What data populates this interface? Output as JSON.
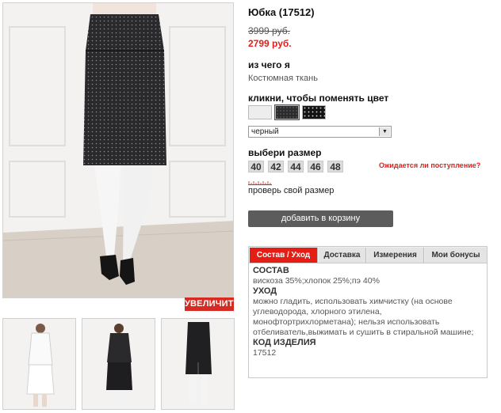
{
  "product": {
    "title": "Юбка (17512)",
    "old_price": "3999 руб.",
    "new_price": "2799 руб."
  },
  "material": {
    "heading": "из чего я",
    "value": "Костюмная ткань"
  },
  "color": {
    "heading": "кликни, чтобы поменять цвет",
    "selected": "черный",
    "swatches": [
      {
        "name": "white",
        "color": "#ededed"
      },
      {
        "name": "black-dotted",
        "color": "#2b2b2e"
      },
      {
        "name": "black-white-dotted",
        "color": "#141414"
      }
    ]
  },
  "size": {
    "heading": "выбери размер",
    "options": [
      "40",
      "42",
      "44",
      "46",
      "48"
    ],
    "expect_link": "Ожидается ли поступление?",
    "check_size": "проверь свой размер"
  },
  "cart": {
    "add_label": "добавить в корзину"
  },
  "gallery": {
    "zoom_label": "УВЕЛИЧИТЬ"
  },
  "tabs": {
    "items": [
      "Состав / Уход",
      "Доставка",
      "Измерения",
      "Мои бонусы"
    ],
    "active": "Состав / Уход",
    "content": {
      "composition_heading": "СОСТАВ",
      "composition": "вискоза 35%;хлопок 25%;пэ 40%",
      "care_heading": "УХОД",
      "care": "можно гладить, использовать химчистку (на основе углеводорода, хлорного этилена, монофтортрихлорметана); нельзя использовать отбеливатель,выжимать и сушить в стиральной машине;",
      "code_heading": "КОД ИЗДЕЛИЯ",
      "code": "17512"
    }
  },
  "colors": {
    "accent": "#e0201a",
    "button": "#5c5c5c",
    "size_box": "#dcdcdc"
  }
}
